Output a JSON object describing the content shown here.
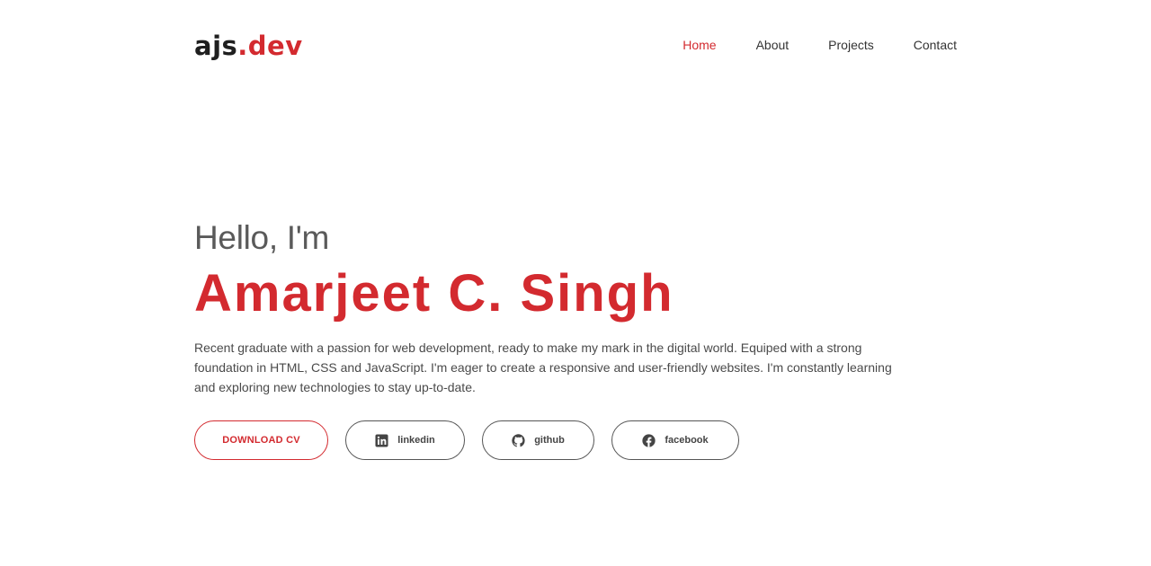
{
  "header": {
    "logo_prefix": "ajs",
    "logo_suffix": ".dev",
    "nav": [
      {
        "label": "Home",
        "active": true
      },
      {
        "label": "About",
        "active": false
      },
      {
        "label": "Projects",
        "active": false
      },
      {
        "label": "Contact",
        "active": false
      }
    ]
  },
  "hero": {
    "greeting": "Hello, I'm",
    "name": "Amarjeet C. Singh",
    "intro": "Recent graduate with a passion for web development, ready to make my mark in the digital world. Equiped with a strong foundation in HTML, CSS and JavaScript. I'm eager to create a responsive and user-friendly websites. I'm constantly learning and exploring new technologies to stay up-to-date.",
    "buttons": {
      "download_cv": "DOWNLOAD CV",
      "linkedin": {
        "label": "linkedin",
        "icon": "linkedin-icon"
      },
      "github": {
        "label": "github",
        "icon": "github-icon"
      },
      "facebook": {
        "label": "facebook",
        "icon": "facebook-icon"
      }
    }
  },
  "colors": {
    "accent": "#d32a2f",
    "text": "#333333",
    "muted": "#5a5a5a",
    "border": "#555555"
  }
}
